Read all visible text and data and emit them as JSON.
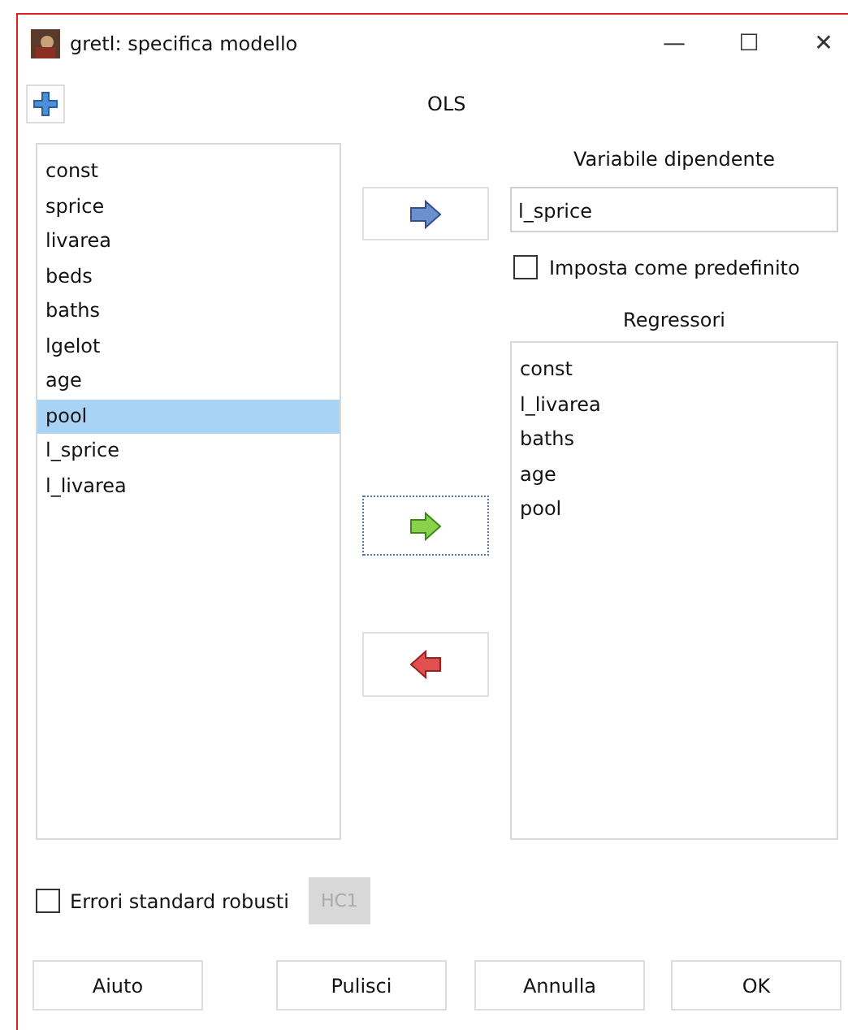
{
  "window": {
    "title": "gretl: specifica modello",
    "controls": [
      "—",
      "☐",
      "✕"
    ]
  },
  "toolbar": {
    "add_button": true
  },
  "estimator": "OLS",
  "variables": [
    {
      "label": "const",
      "selected": false
    },
    {
      "label": "sprice",
      "selected": false
    },
    {
      "label": "livarea",
      "selected": false
    },
    {
      "label": "beds",
      "selected": false
    },
    {
      "label": "baths",
      "selected": false
    },
    {
      "label": "lgelot",
      "selected": false
    },
    {
      "label": "age",
      "selected": false
    },
    {
      "label": "pool",
      "selected": true
    },
    {
      "label": "l_sprice",
      "selected": false
    },
    {
      "label": "l_livarea",
      "selected": false
    }
  ],
  "move_buttons": [
    {
      "kind": "set-dependent",
      "focused": false
    },
    {
      "kind": "add",
      "focused": true
    },
    {
      "kind": "remove",
      "focused": false
    }
  ],
  "dependent": {
    "label": "Variabile dipendente",
    "value": "l_sprice"
  },
  "default_option": {
    "label": "Imposta come predefinito",
    "checked": false
  },
  "regressors": {
    "label": "Regressori",
    "items": [
      "const",
      "l_livarea",
      "baths",
      "age",
      "pool"
    ]
  },
  "robust": {
    "label": "Errori standard robusti",
    "checked": false,
    "variant": "HC1",
    "variant_disabled": true
  },
  "buttons": [
    "Aiuto",
    "Pulisci",
    "Annulla",
    "OK"
  ]
}
